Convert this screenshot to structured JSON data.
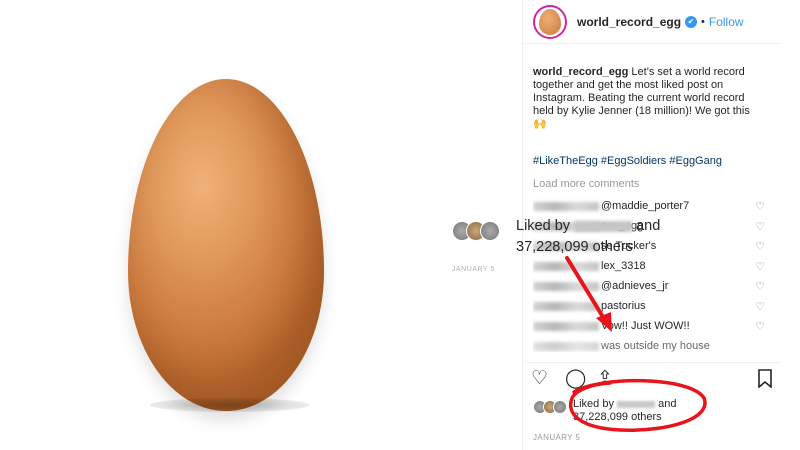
{
  "post": {
    "username": "world_record_egg",
    "verified_glyph": "✔",
    "separator": "•",
    "follow_label": "Follow",
    "caption_user": "world_record_egg",
    "caption_text": "Let's set a world record together and get the most liked post on Instagram. Beating the current world record held by Kylie Jenner (18 million)! We got this 🙌",
    "hashtags": "#LikeTheEgg #EggSoldiers #EggGang",
    "load_more": "Load more comments",
    "comments": [
      {
        "text": "@maddie_porter7"
      },
      {
        "text": "ous_egg"
      },
      {
        "text": "se Tucker's"
      },
      {
        "text": "lex_3318"
      },
      {
        "text": "@adnieves_jr"
      },
      {
        "text": "pastorius"
      },
      {
        "text": "Vow!! Just WOW!!"
      },
      {
        "text": "was outside my house"
      }
    ],
    "likes_prefix": "Liked by",
    "likes_mid": "and",
    "likes_count": "37,228,099 others",
    "date": "JANUARY 5",
    "icons": {
      "heart": "heart-icon",
      "comment": "comment-icon",
      "share": "share-icon",
      "bookmark": "bookmark-icon",
      "comment_heart": "heart-outline-icon"
    }
  },
  "callout": {
    "likes_prefix": "Liked by",
    "likes_mid": "and",
    "likes_count": "37,228,099 others",
    "faded_date": "JANUARY 5"
  },
  "colors": {
    "link_blue": "#3897f0",
    "hashtag": "#003569",
    "annotation_red": "#e8141a",
    "egg": "#e19a5d"
  }
}
